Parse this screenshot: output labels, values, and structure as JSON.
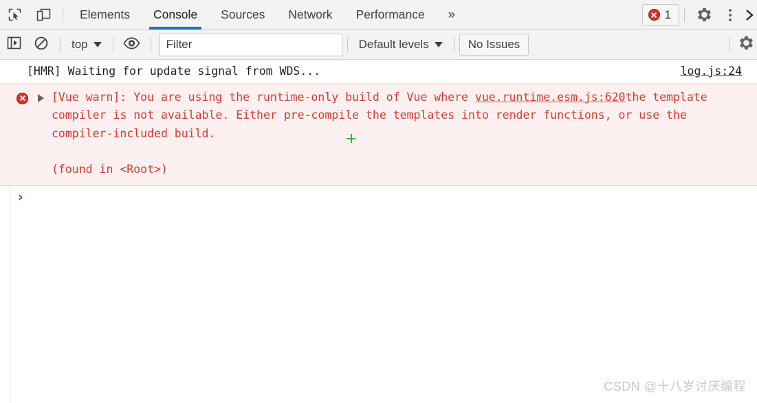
{
  "tabbar": {
    "inspect_icon": "cursor-select-icon",
    "device_icon": "device-toolbar-icon",
    "tabs": [
      {
        "label": "Elements",
        "active": false
      },
      {
        "label": "Console",
        "active": true
      },
      {
        "label": "Sources",
        "active": false
      },
      {
        "label": "Network",
        "active": false
      },
      {
        "label": "Performance",
        "active": false
      }
    ],
    "more_tabs_label": "»",
    "error_count": "1",
    "settings_icon": "gear-icon",
    "menu_icon": "kebab-menu-icon",
    "close_icon": "chevron-right-icon",
    "active_underline_color": "#1a73c8",
    "error_color": "#d93025"
  },
  "filterbar": {
    "sidebar_toggle_icon": "console-sidebar-icon",
    "clear_icon": "clear-console-icon",
    "context_label": "top",
    "eye_icon": "live-expression-icon",
    "filter_placeholder": "Filter",
    "filter_value": "",
    "levels_label": "Default levels",
    "issues_label": "No Issues",
    "settings_icon": "gear-icon"
  },
  "console": {
    "messages": [
      {
        "type": "info",
        "text": "[HMR] Waiting for update signal from WDS...",
        "source": "log.js:24"
      },
      {
        "type": "error",
        "icon": "error-circle-icon",
        "expander": "collapsed-triangle-icon",
        "line1_a": "[Vue warn]: You are using the runtime-only build of Vue where ",
        "source": "vue.runtime.esm.js:620",
        "line1_b": "the template compiler is not available. Either pre-compile the templates into render functions, or use the compiler-included build.",
        "footer": "(found in <Root>)"
      }
    ],
    "prompt": "›"
  },
  "watermark": "CSDN @十八岁讨厌编程"
}
